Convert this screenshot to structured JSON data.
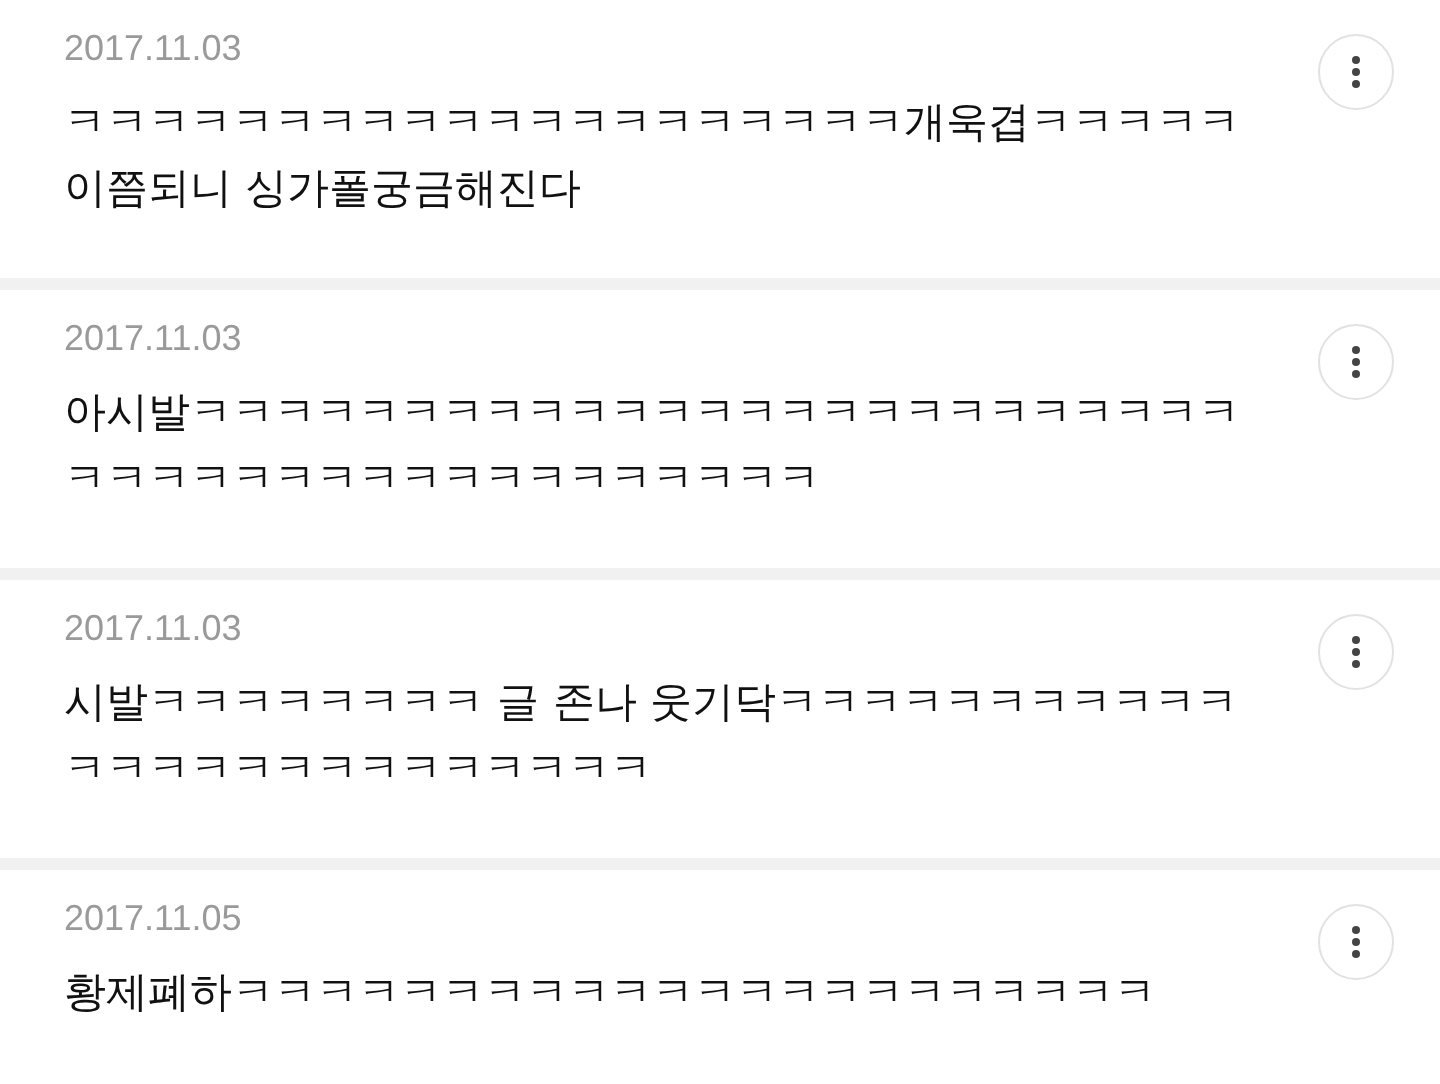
{
  "comments": [
    {
      "date": "2017.11.03",
      "text": "ㅋㅋㅋㅋㅋㅋㅋㅋㅋㅋㅋㅋㅋㅋㅋㅋㅋㅋㅋㅋ개욱겹ㅋㅋㅋㅋㅋ이쯤되니 싱가폴궁금해진다"
    },
    {
      "date": "2017.11.03",
      "text": "아시발ㅋㅋㅋㅋㅋㅋㅋㅋㅋㅋㅋㅋㅋㅋㅋㅋㅋㅋㅋㅋㅋㅋㅋㅋㅋㅋㅋㅋㅋㅋㅋㅋㅋㅋㅋㅋㅋㅋㅋㅋㅋㅋㅋ"
    },
    {
      "date": "2017.11.03",
      "text": "시발ㅋㅋㅋㅋㅋㅋㅋㅋ 글 존나 웃기닥ㅋㅋㅋㅋㅋㅋㅋㅋㅋㅋㅋㅋㅋㅋㅋㅋㅋㅋㅋㅋㅋㅋㅋㅋㅋ"
    },
    {
      "date": "2017.11.05",
      "text": "황제폐하ㅋㅋㅋㅋㅋㅋㅋㅋㅋㅋㅋㅋㅋㅋㅋㅋㅋㅋㅋㅋㅋㅋ"
    }
  ]
}
